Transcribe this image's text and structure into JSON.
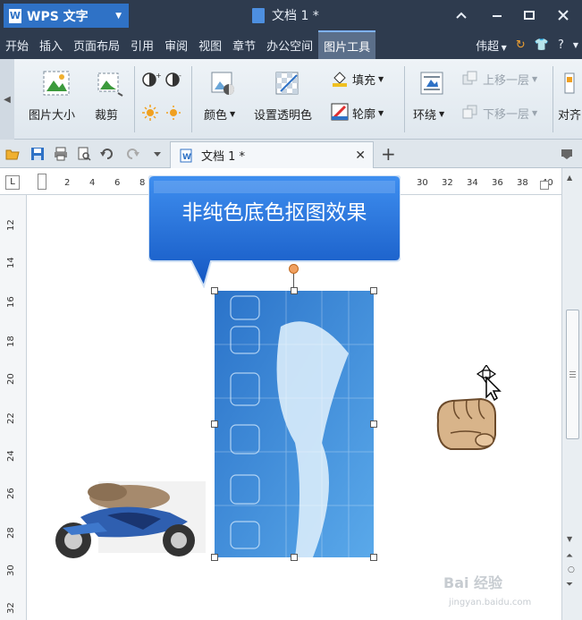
{
  "titlebar": {
    "app_name": "WPS 文字",
    "app_icon": "W",
    "doc_title": "文档 1 *"
  },
  "menu": {
    "items": [
      "开始",
      "插入",
      "页面布局",
      "引用",
      "审阅",
      "视图",
      "章节",
      "办公空间",
      "图片工具"
    ],
    "active_index": 8,
    "user": "伟超"
  },
  "ribbon": {
    "picture_size": "图片大小",
    "crop": "裁剪",
    "color": "颜色",
    "set_transparent": "设置透明色",
    "fill": "填充",
    "outline": "轮廓",
    "wrap": "环绕",
    "bring_forward": "上移一层",
    "send_backward": "下移一层",
    "align": "对齐"
  },
  "tabs": {
    "doc_tab_label": "文档 1 *"
  },
  "ruler": {
    "h_ticks": [
      "2",
      "4",
      "6",
      "8",
      "30",
      "32",
      "34",
      "36",
      "38",
      "40"
    ],
    "v_ticks": [
      "12",
      "14",
      "16",
      "18",
      "20",
      "22",
      "24",
      "26",
      "28",
      "30",
      "32"
    ]
  },
  "callout": {
    "text": "非纯色底色抠图效果"
  },
  "watermark": {
    "text": "Bai 经验",
    "url": "jingyan.baidu.com"
  },
  "colors": {
    "title_bg": "#2e3b4e",
    "accent": "#2f72c6",
    "callout": "#1f6fd6"
  }
}
